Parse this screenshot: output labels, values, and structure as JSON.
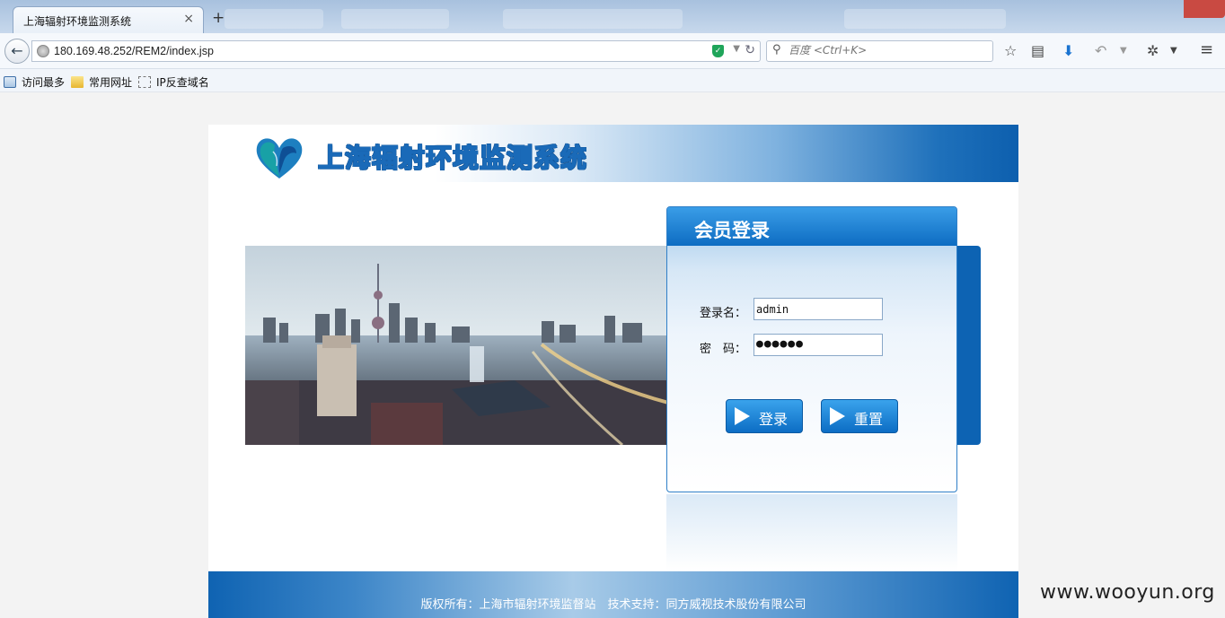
{
  "browser": {
    "tab_title": "上海辐射环境监测系统",
    "tab_close": "×",
    "new_tab": "+",
    "url": "180.169.48.252/REM2/index.jsp",
    "search_placeholder": "百度 <Ctrl+K>",
    "bookmarks": [
      "访问最多",
      "常用网址",
      "IP反查域名"
    ]
  },
  "page": {
    "site_title": "上海辐射环境监测系统",
    "login": {
      "title": "会员登录",
      "username_label": "登录名：",
      "username_value": "admin",
      "password_label": "密　码：",
      "password_mask": "●●●●●●",
      "login_button": "登录",
      "reset_button": "重置"
    },
    "footer": "版权所有：上海市辐射环境监督站　技术支持：同方威视技术股份有限公司"
  },
  "watermark": "www.wooyun.org",
  "colors": {
    "brand_blue": "#0d63b3",
    "button_blue": "#1f85d6"
  }
}
